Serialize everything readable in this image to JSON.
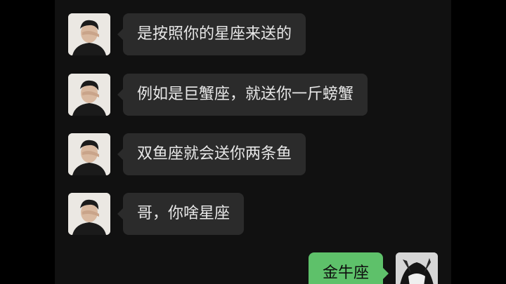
{
  "messages": [
    {
      "side": "left",
      "text": "是按照你的星座来送的",
      "avatar": "avatar-boy-covering-eye"
    },
    {
      "side": "left",
      "text": "例如是巨蟹座，就送你一斤螃蟹",
      "avatar": "avatar-boy-covering-eye"
    },
    {
      "side": "left",
      "text": "双鱼座就会送你两条鱼",
      "avatar": "avatar-boy-covering-eye"
    },
    {
      "side": "left",
      "text": "哥，你啥星座",
      "avatar": "avatar-boy-covering-eye"
    },
    {
      "side": "right",
      "text": "金牛座",
      "avatar": "avatar-anime-dark-hair"
    }
  ],
  "colors": {
    "background": "#111111",
    "incoming_bubble": "#2b2b2b",
    "outgoing_bubble": "#5ec16a"
  }
}
